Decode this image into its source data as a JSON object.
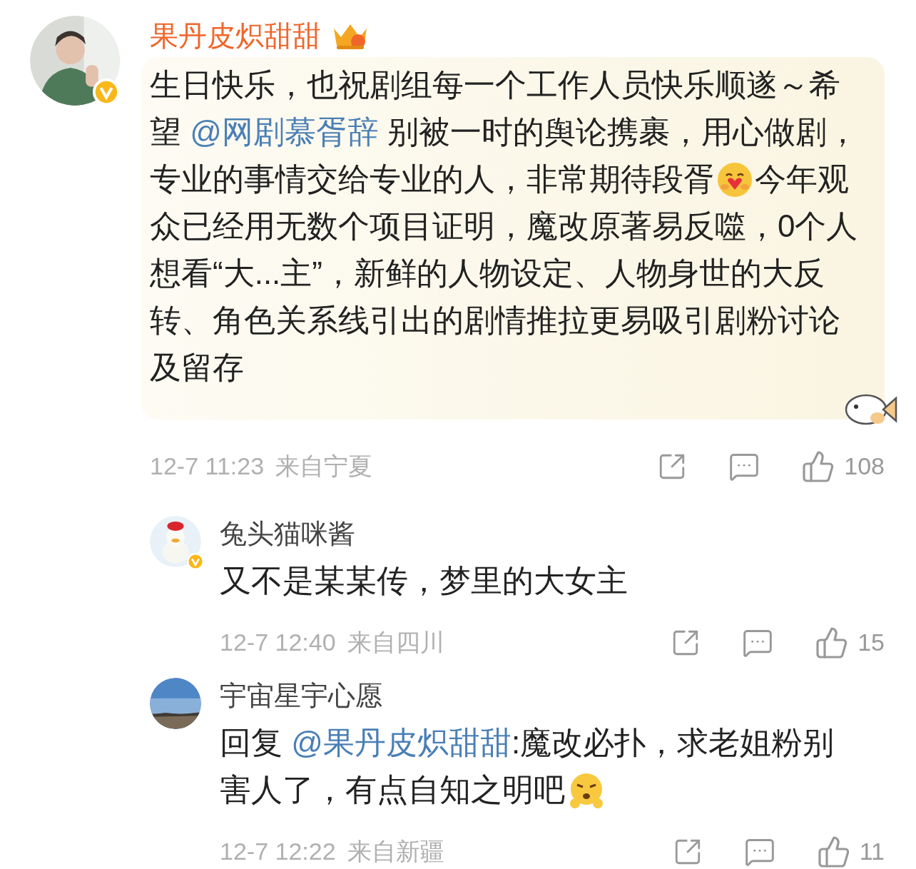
{
  "comments": [
    {
      "author": "果丹皮炽甜甜",
      "crown": true,
      "verified": true,
      "bubble": true,
      "body": [
        {
          "kind": "text",
          "text": "生日快乐，也祝剧组每一个工作人员快乐顺遂～希望 "
        },
        {
          "kind": "mention",
          "text": "@网剧慕胥辞"
        },
        {
          "kind": "text",
          "text": " 别被一时的舆论携裹，用心做剧，专业的事情交给专业的人，非常期待段胥"
        },
        {
          "kind": "hug"
        },
        {
          "kind": "text",
          "text": "今年观众已经用无数个项目证明，魔改原著易反噬，0个人想看“大...主”，新鲜的人物设定、人物身世的大反转、角色关系线引出的剧情推拉更易吸引剧粉讨论及留存"
        }
      ],
      "time": "12-7 11:23",
      "location": "来自宁夏",
      "likes": "108",
      "children": [
        {
          "author": "兔头猫咪酱",
          "crown": false,
          "verified": true,
          "bubble": false,
          "body": [
            {
              "kind": "text",
              "text": "又不是某某传，梦里的大女主"
            }
          ],
          "time": "12-7 12:40",
          "location": "来自四川",
          "likes": "15"
        },
        {
          "author": "宇宙星宇心愿",
          "crown": false,
          "verified": false,
          "bubble": false,
          "body": [
            {
              "kind": "text",
              "text": "回复 "
            },
            {
              "kind": "mention",
              "text": "@果丹皮炽甜甜"
            },
            {
              "kind": "text",
              "text": ":魔改必扑，求老姐粉别害人了，有点自知之明吧"
            },
            {
              "kind": "huff"
            }
          ],
          "time": "12-7 12:22",
          "location": "来自新疆",
          "likes": "11"
        }
      ]
    }
  ]
}
